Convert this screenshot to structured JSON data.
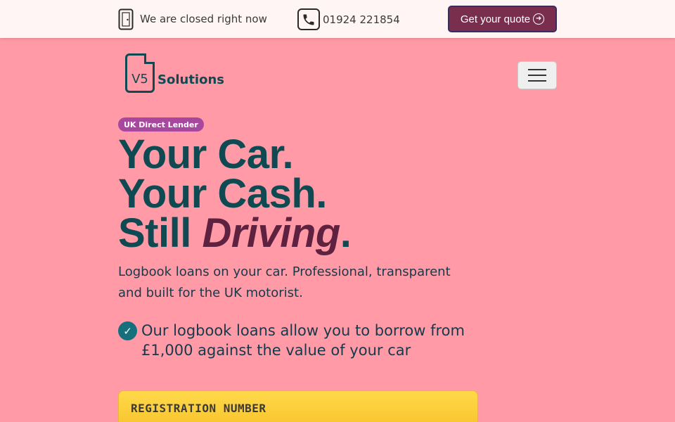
{
  "topbar": {
    "status_icon": "door-icon",
    "status_text": "We are closed right now",
    "phone_icon": "phone-icon",
    "phone_number": "01924 221854",
    "quote_label": "Get your quote",
    "quote_icon": "arrow-right-circle-icon"
  },
  "brand": {
    "logo_doc_text": "V5",
    "logo_name": "Solutions"
  },
  "nav": {
    "menu_icon": "hamburger-icon"
  },
  "hero": {
    "badge": "UK Direct Lender",
    "line1": "Your Car.",
    "line2": "Your Cash.",
    "line3_prefix": "Still ",
    "line3_emphasis": "Driving",
    "line3_suffix": ".",
    "lede": "Logbook loans on your car. Professional, transparent and built for the UK motorist.",
    "feature_icon": "check-circle-icon",
    "feature_text": "Our logbook loans allow you to borrow from £1,000 against the value of your car"
  },
  "form": {
    "registration_label": "REGISTRATION NUMBER"
  },
  "colors": {
    "background": "#ff9aa6",
    "topbar": "#fff5f5",
    "brand_teal": "#0f4a52",
    "accent_plum": "#7a2e4e",
    "badge": "#a7479e",
    "panel_yellow": "#ffd94a"
  }
}
